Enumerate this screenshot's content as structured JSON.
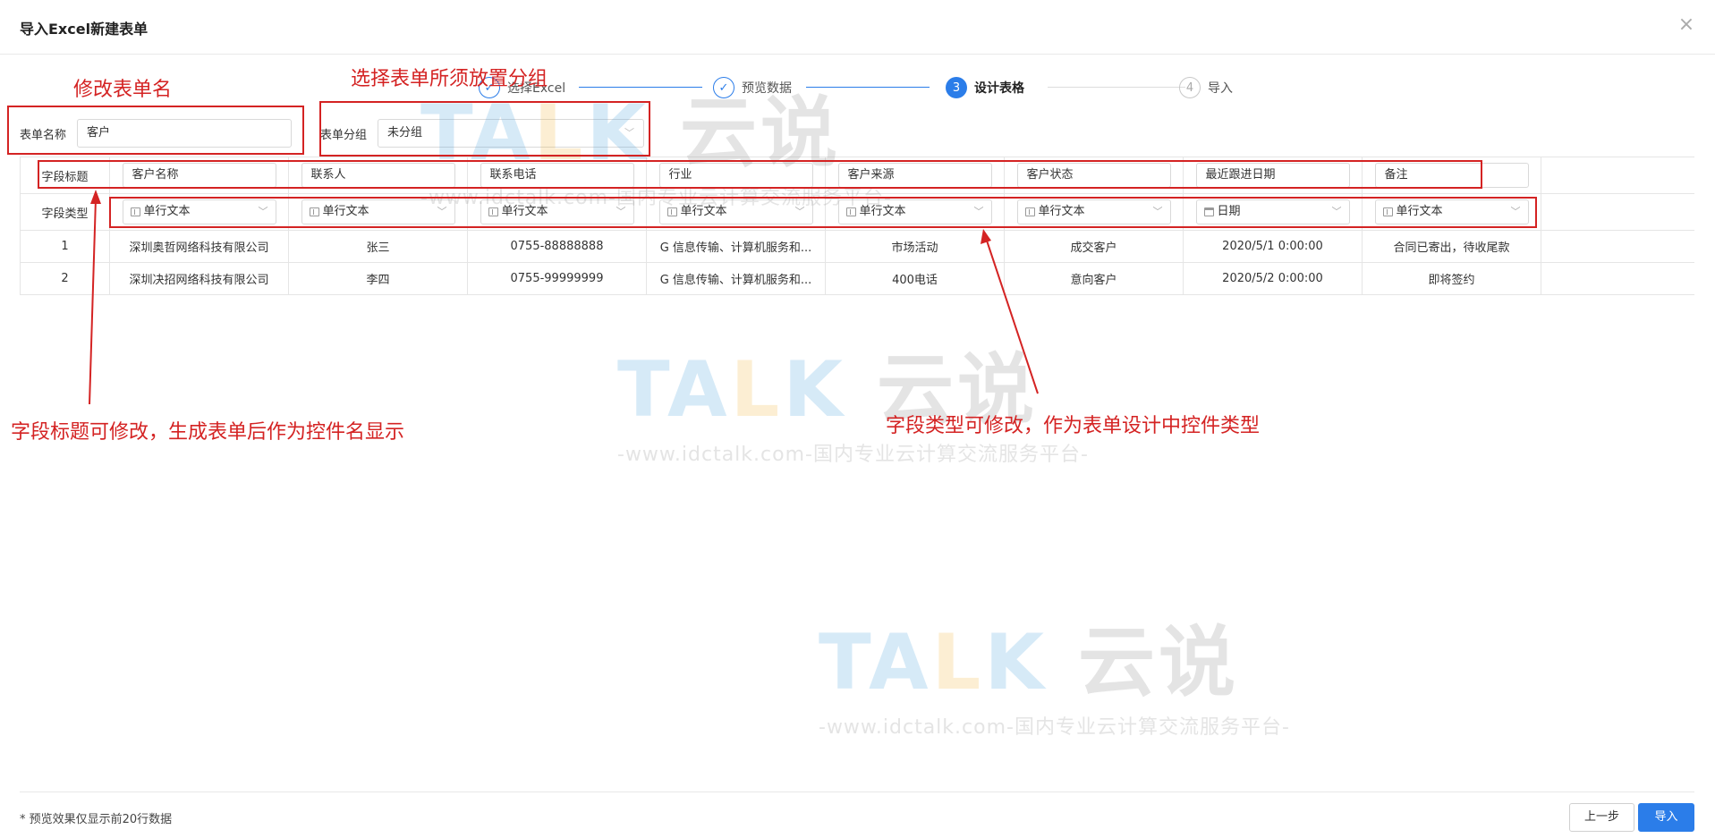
{
  "window": {
    "title": "导入Excel新建表单"
  },
  "steps": [
    {
      "number": "1",
      "label": "选择Excel",
      "state": "done"
    },
    {
      "number": "2",
      "label": "预览数据",
      "state": "done"
    },
    {
      "number": "3",
      "label": "设计表格",
      "state": "active"
    },
    {
      "number": "4",
      "label": "导入",
      "state": "todo"
    }
  ],
  "form": {
    "name_label": "表单名称",
    "name_value": "客户",
    "group_label": "表单分组",
    "group_value": "未分组"
  },
  "table": {
    "title_row_label": "字段标题",
    "type_row_label": "字段类型",
    "field_titles": [
      "客户名称",
      "联系人",
      "联系电话",
      "行业",
      "客户来源",
      "客户状态",
      "最近跟进日期",
      "备注"
    ],
    "field_types": [
      {
        "label": "单行文本",
        "icon": "text-field-icon"
      },
      {
        "label": "单行文本",
        "icon": "text-field-icon"
      },
      {
        "label": "单行文本",
        "icon": "text-field-icon"
      },
      {
        "label": "单行文本",
        "icon": "text-field-icon"
      },
      {
        "label": "单行文本",
        "icon": "text-field-icon"
      },
      {
        "label": "单行文本",
        "icon": "text-field-icon"
      },
      {
        "label": "日期",
        "icon": "calendar-icon"
      },
      {
        "label": "单行文本",
        "icon": "text-field-icon"
      }
    ],
    "rows": [
      {
        "index": "1",
        "cells": [
          "深圳奥哲网络科技有限公司",
          "张三",
          "0755-88888888",
          "G 信息传输、计算机服务和...",
          "市场活动",
          "成交客户",
          "2020/5/1 0:00:00",
          "合同已寄出，待收尾款"
        ]
      },
      {
        "index": "2",
        "cells": [
          "深圳决招网络科技有限公司",
          "李四",
          "0755-99999999",
          "G 信息传输、计算机服务和...",
          "400电话",
          "意向客户",
          "2020/5/2 0:00:00",
          "即将签约"
        ]
      }
    ]
  },
  "annotations": {
    "rename_form": "修改表单名",
    "choose_group": "选择表单所须放置分组",
    "field_title_note": "字段标题可修改，生成表单后作为控件名显示",
    "field_type_note": "字段类型可修改，作为表单设计中控件类型"
  },
  "watermark": {
    "logo_part1": "TA",
    "logo_part2": "L",
    "logo_part3": "K",
    "logo_cn": "云说",
    "tagline": "-www.idctalk.com-国内专业云计算交流服务平台-"
  },
  "footer": {
    "note": "* 预览效果仅显示前20行数据",
    "prev_label": "上一步",
    "import_label": "导入"
  },
  "colors": {
    "accent": "#2b7de9",
    "annotation": "#d42323"
  }
}
